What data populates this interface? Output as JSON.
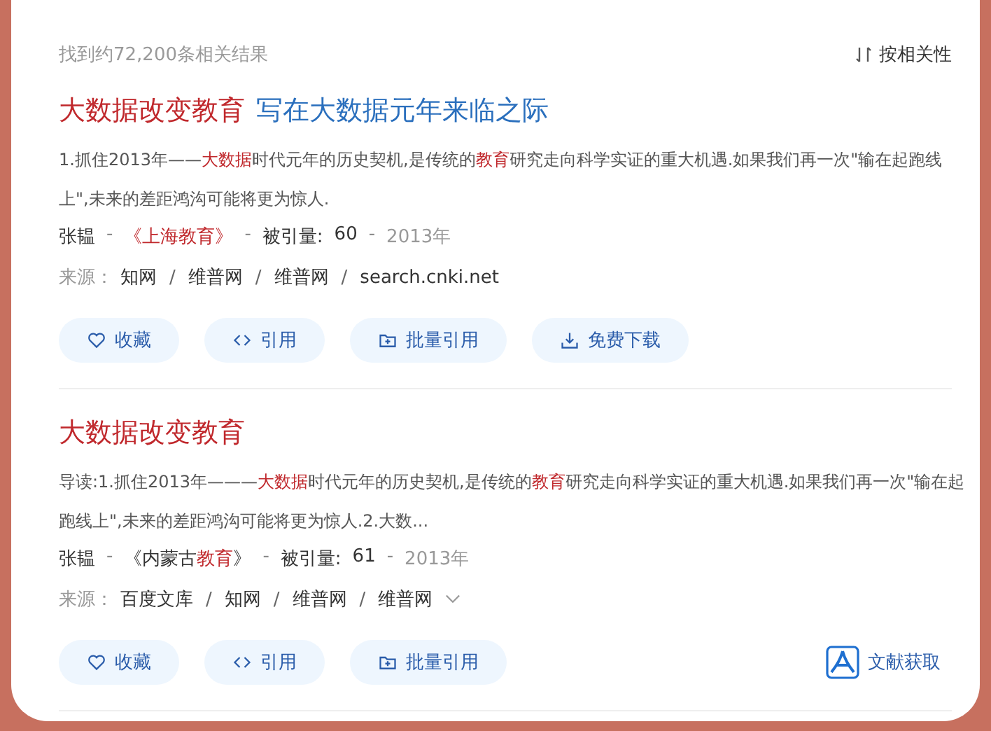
{
  "summary": "找到约72,200条相关结果",
  "sort": {
    "label": "按相关性"
  },
  "results": [
    {
      "title": "大数据改变教育",
      "subtitle": "写在大数据元年来临之际",
      "snippet": "1.抓住2013年——**大数据**时代元年的历史契机,是传统的**教育**研究走向科学实证的重大机遇.如果我们再一次\"输在起跑线上\",未来的差距鸿沟可能将更为惊人.",
      "author": "张韫",
      "journal": "**《上海教育》**",
      "cited_label": "被引量:",
      "cited": "60",
      "year": "2013年",
      "source_label": "来源：",
      "meta_sep": "-",
      "source_sep": "/",
      "sources": [
        "知网",
        "维普网",
        "维普网",
        "search.cnki.net"
      ],
      "collapsible": false,
      "actions": [
        {
          "kind": "favorite",
          "label": "收藏"
        },
        {
          "kind": "cite",
          "label": "引用"
        },
        {
          "kind": "batch",
          "label": "批量引用"
        },
        {
          "kind": "download",
          "label": "免费下载"
        }
      ]
    },
    {
      "title": "大数据改变教育",
      "snippet": "导读:1.抓住2013年———**大数据**时代元年的历史契机,是传统的**教育**研究走向科学实证的重大机遇.如果我们再一次\"输在起跑线上\",未来的差距鸿沟可能将更为惊人.2.大数...",
      "author": "张韫",
      "journal": "《内蒙古**教育**》",
      "cited_label": "被引量:",
      "cited": "61",
      "year": "2013年",
      "source_label": "来源：",
      "meta_sep": "-",
      "source_sep": "/",
      "sources": [
        "百度文库",
        "知网",
        "维普网",
        "维普网"
      ],
      "collapsible": true,
      "actions": [
        {
          "kind": "favorite",
          "label": "收藏"
        },
        {
          "kind": "cite",
          "label": "引用"
        },
        {
          "kind": "batch",
          "label": "批量引用"
        },
        {
          "kind": "fulltext",
          "label": "文献获取"
        }
      ]
    }
  ]
}
